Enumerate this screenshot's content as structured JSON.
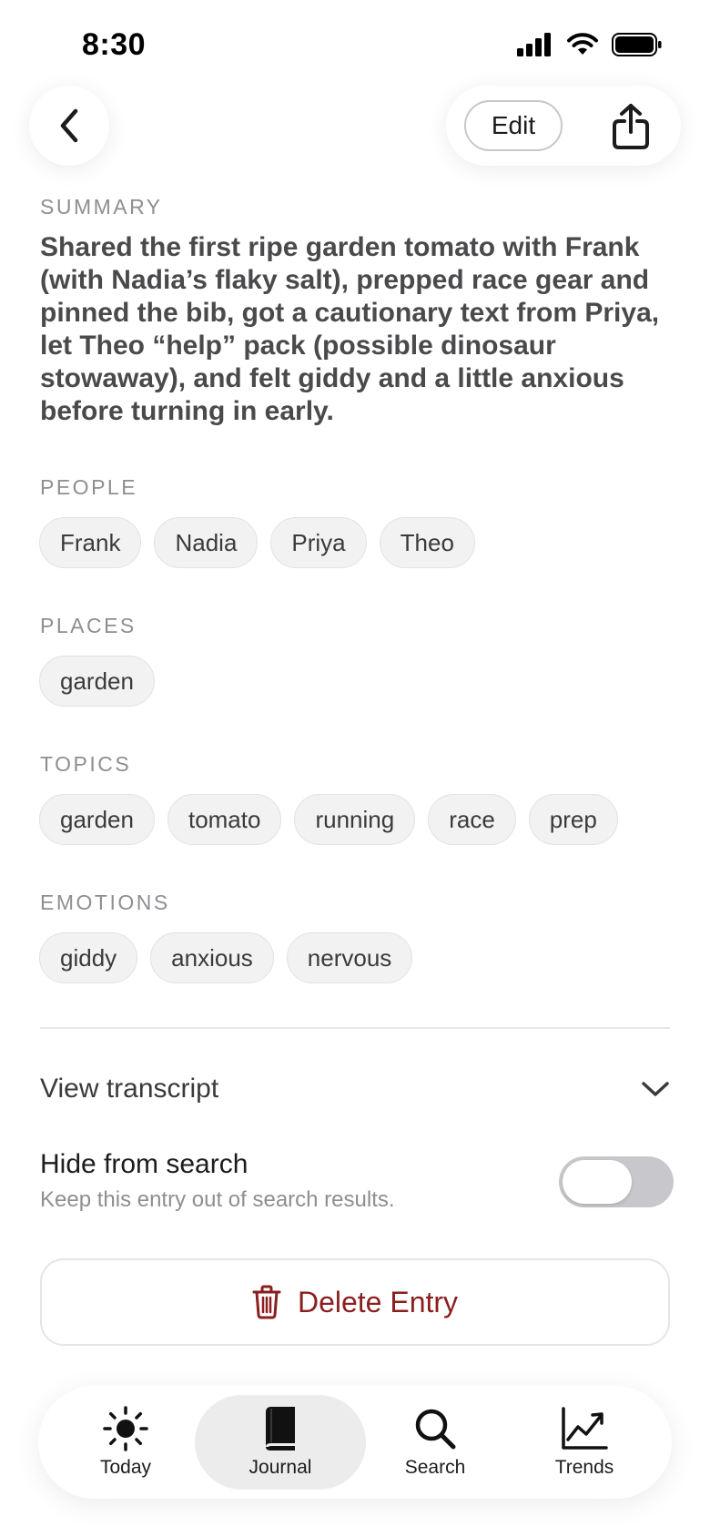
{
  "status_bar": {
    "time": "8:30"
  },
  "header": {
    "edit_label": "Edit"
  },
  "summary": {
    "label": "SUMMARY",
    "lines": [
      "Shared the first ripe garden tomato with Frank",
      "(with Nadia’s flaky salt), prepped race gear and",
      "pinned the bib, got a cautionary text from Priya,",
      "let Theo “help” pack (possible dinosaur",
      "stowaway), and felt giddy and a little anxious",
      "before turning in early."
    ]
  },
  "people": {
    "label": "PEOPLE",
    "items": [
      "Frank",
      "Nadia",
      "Priya",
      "Theo"
    ]
  },
  "places": {
    "label": "PLACES",
    "items": [
      "garden"
    ]
  },
  "topics": {
    "label": "TOPICS",
    "items": [
      "garden",
      "tomato",
      "running",
      "race",
      "prep"
    ]
  },
  "emotions": {
    "label": "EMOTIONS",
    "items": [
      "giddy",
      "anxious",
      "nervous"
    ]
  },
  "transcript": {
    "label": "View transcript"
  },
  "hide_search": {
    "title": "Hide from search",
    "subtitle": "Keep this entry out of search results.",
    "enabled": false
  },
  "delete": {
    "label": "Delete Entry",
    "color": "#8b1e1e"
  },
  "tabs": [
    {
      "label": "Today",
      "icon": "sun-icon",
      "active": false
    },
    {
      "label": "Journal",
      "icon": "book-icon",
      "active": true
    },
    {
      "label": "Search",
      "icon": "search-icon",
      "active": false
    },
    {
      "label": "Trends",
      "icon": "trend-chart-icon",
      "active": false
    }
  ]
}
